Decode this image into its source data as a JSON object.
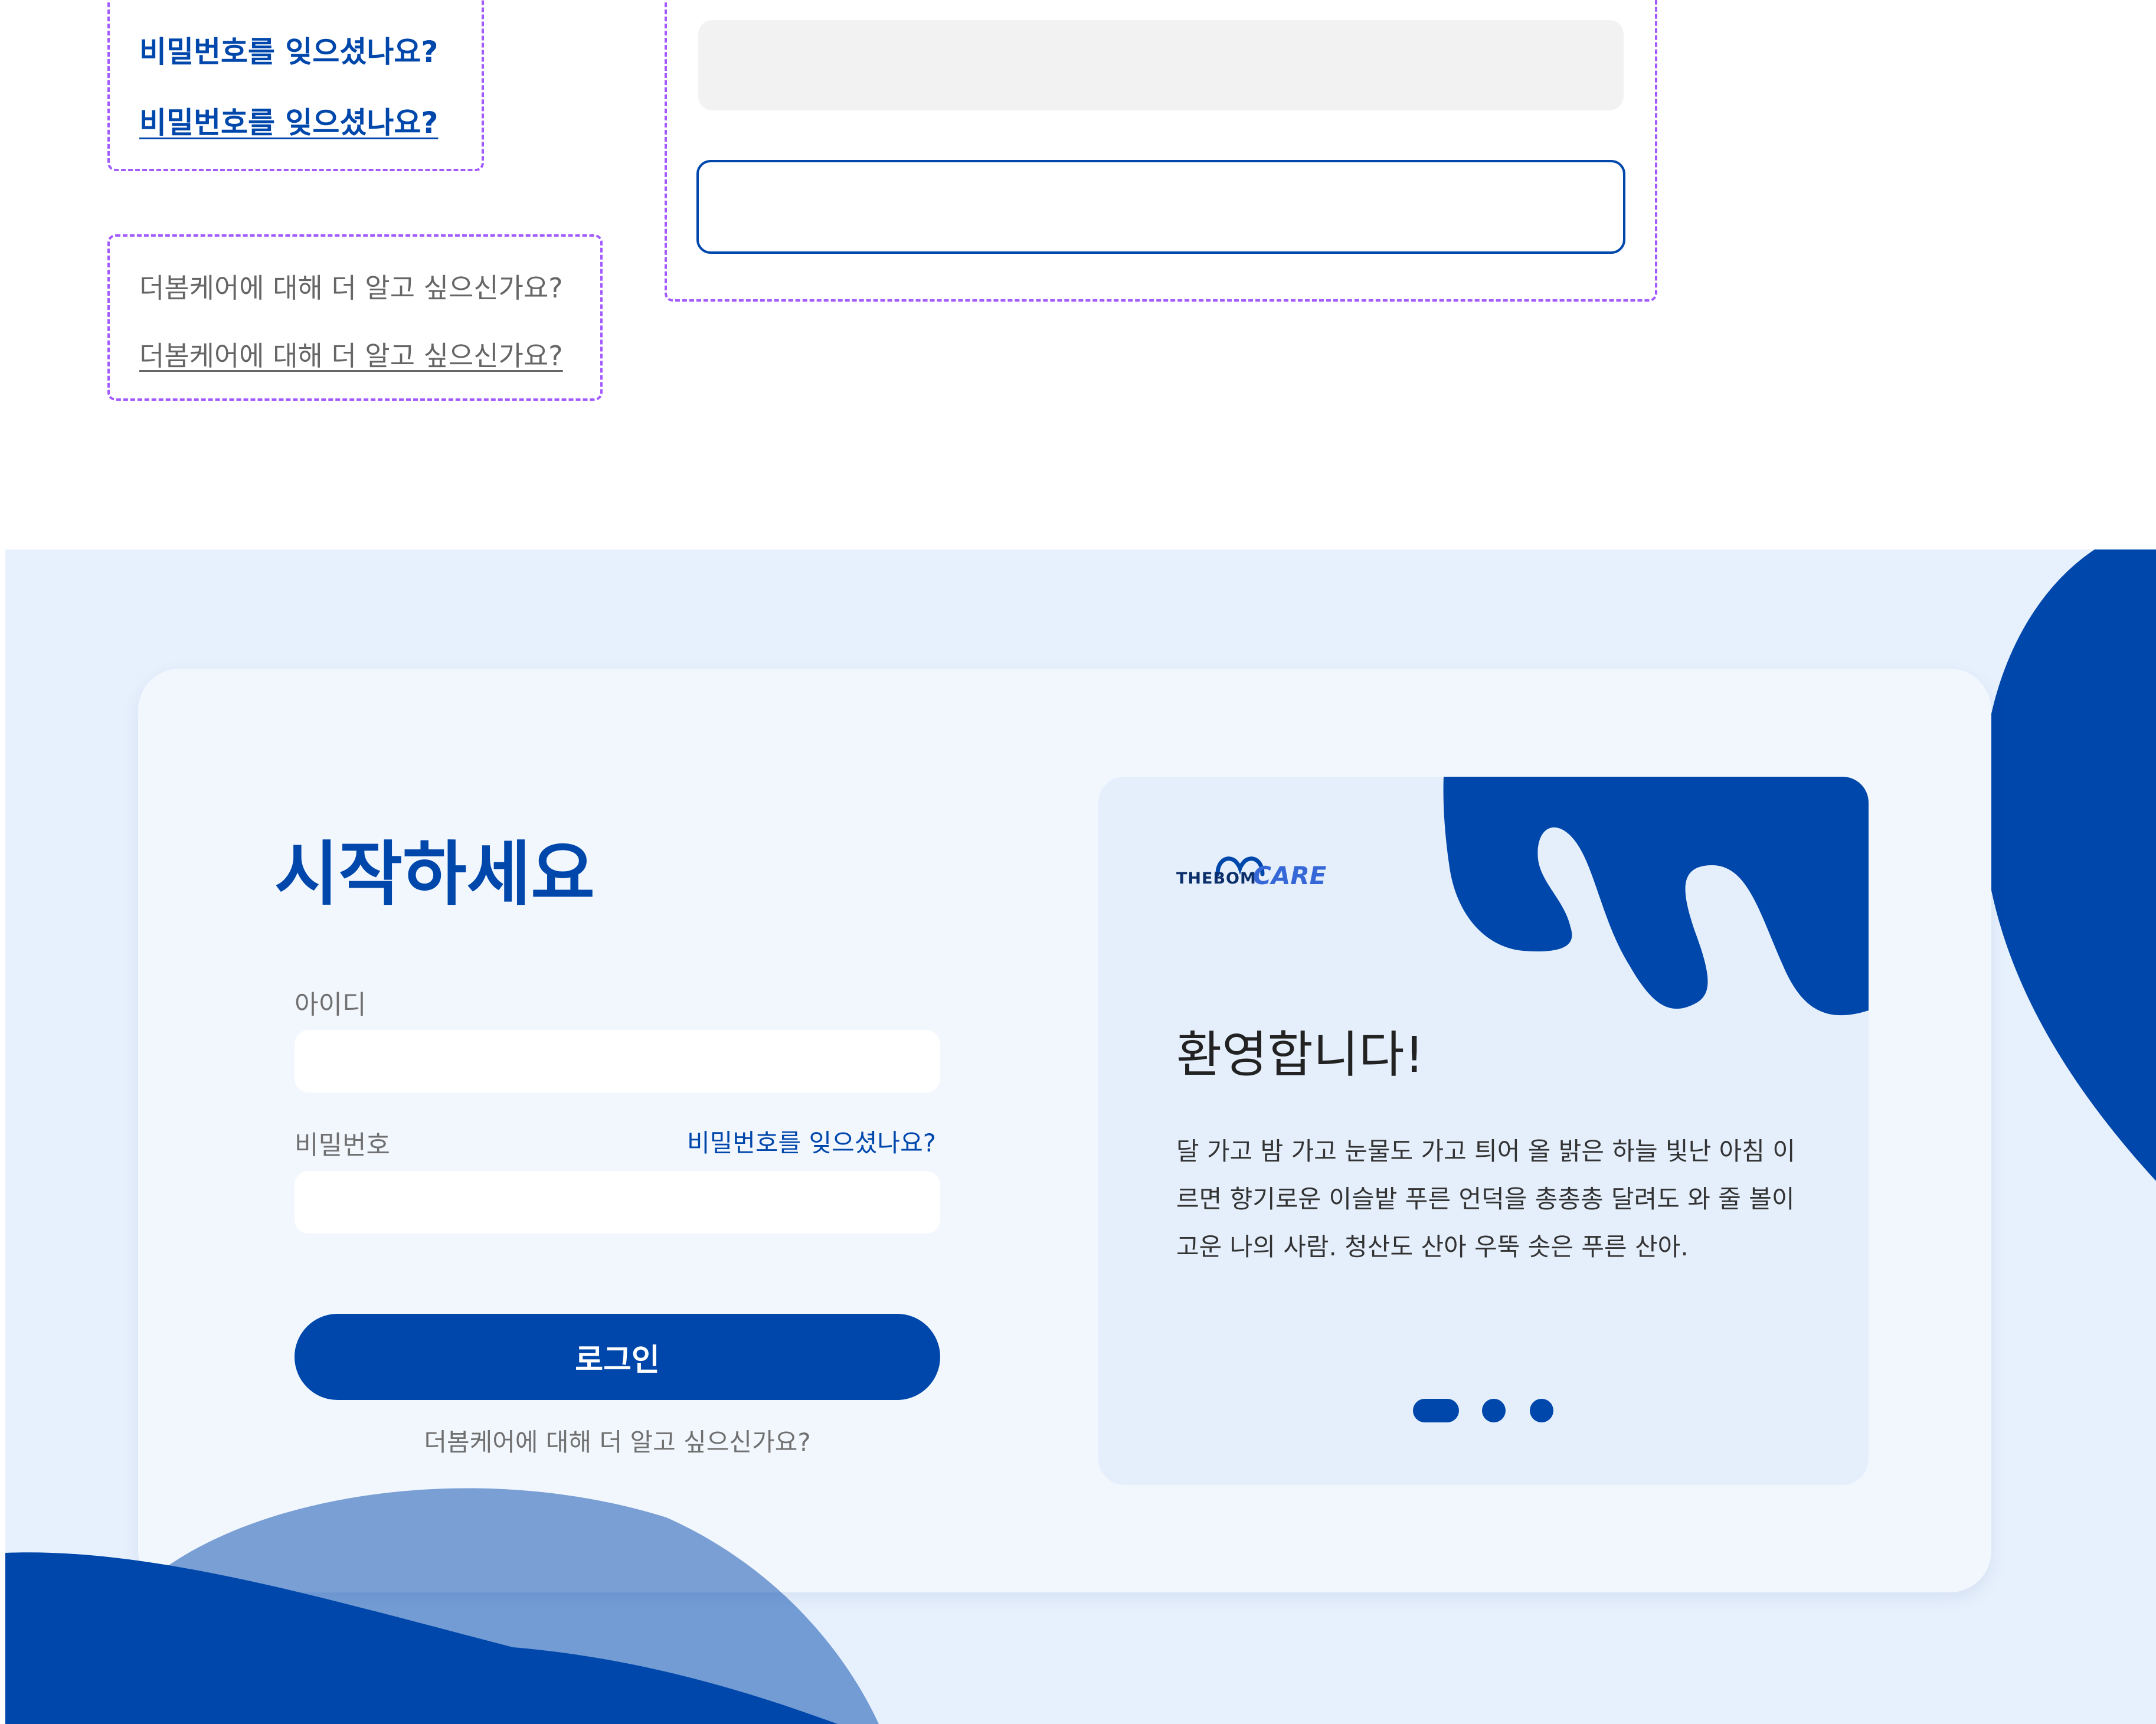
{
  "spec": {
    "forgot_link_default": "비밀번호를 잊으셨나요?",
    "forgot_link_hover": "비밀번호를 잊으셨나요?",
    "learn_link_default": "더봄케어에 대해 더 알고 싶으신가요?",
    "learn_link_hover": "더봄케어에 대해 더 알고 싶으신가요?"
  },
  "login": {
    "title": "시작하세요",
    "id_label": "아이디",
    "password_label": "비밀번호",
    "forgot_link": "비밀번호를 잊으셨나요?",
    "submit_label": "로그인",
    "learn_link": "더봄케어에 대해 더 알고 싶으신가요?"
  },
  "welcome": {
    "logo_prefix": "THEBOM",
    "logo_suffix": "CARE",
    "title": "환영합니다!",
    "body": "달 가고 밤 가고 눈물도 가고 틔어 올 밝은 하늘 빛난 아침 이르면 향기로운 이슬밭 푸른 언덕을 총총총 달려도 와 줄 볼이 고운 나의 사람. 청산도 산아 우뚝 솟은 푸른 산아.",
    "slides_total": 3,
    "slide_active": 1
  },
  "colors": {
    "brand": "#0047ab",
    "section_bg": "#e7f1fd",
    "card_bg": "#f2f7fe",
    "spec_outline": "#a259ff"
  }
}
